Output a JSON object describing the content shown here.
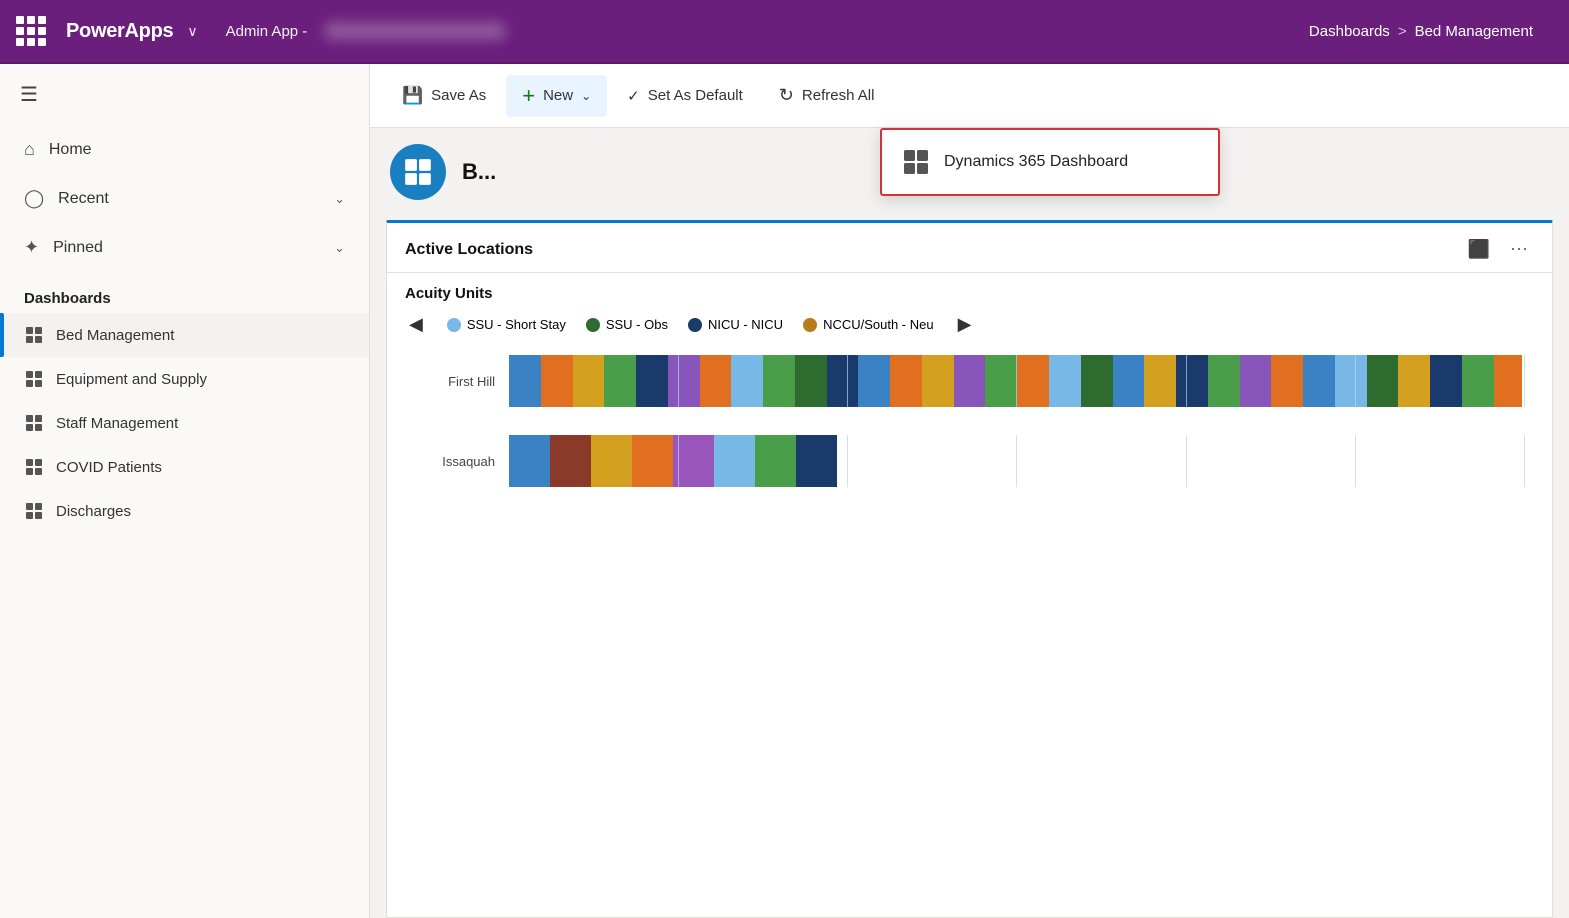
{
  "topbar": {
    "brand": "PowerApps",
    "chevron": "∨",
    "app_name": "Admin App -",
    "breadcrumb_section": "Dashboards",
    "breadcrumb_sep": ">",
    "breadcrumb_page": "Bed Management"
  },
  "toolbar": {
    "save_as_label": "Save As",
    "new_label": "New",
    "set_default_label": "Set As Default",
    "refresh_label": "Refresh All"
  },
  "dropdown": {
    "item_label": "Dynamics 365 Dashboard"
  },
  "sidebar": {
    "home_label": "Home",
    "recent_label": "Recent",
    "pinned_label": "Pinned",
    "dashboards_label": "Dashboards",
    "items": [
      {
        "label": "Bed Management",
        "active": true
      },
      {
        "label": "Equipment and Supply",
        "active": false
      },
      {
        "label": "Staff Management",
        "active": false
      },
      {
        "label": "COVID Patients",
        "active": false
      },
      {
        "label": "Discharges",
        "active": false
      }
    ]
  },
  "dashboard": {
    "title": "B...",
    "chart": {
      "title": "Active Locations",
      "subtitle": "Acuity Units",
      "legend": [
        {
          "label": "SSU - Short Stay",
          "color": "#78b8e6"
        },
        {
          "label": "SSU - Obs",
          "color": "#2e6b2e"
        },
        {
          "label": "NICU - NICU",
          "color": "#1a3a6b"
        },
        {
          "label": "NCCU/South - Neu",
          "color": "#b87c1a"
        }
      ],
      "rows": [
        {
          "label": "First Hill",
          "segments": [
            {
              "color": "#3b82c4",
              "width": 3
            },
            {
              "color": "#e07020",
              "width": 3
            },
            {
              "color": "#d4a020",
              "width": 3
            },
            {
              "color": "#4a9e4a",
              "width": 3
            },
            {
              "color": "#1a3a6b",
              "width": 3
            },
            {
              "color": "#8855bb",
              "width": 3
            },
            {
              "color": "#e07020",
              "width": 3
            },
            {
              "color": "#78b8e6",
              "width": 3
            },
            {
              "color": "#4a9e4a",
              "width": 3
            },
            {
              "color": "#2e6b2e",
              "width": 3
            },
            {
              "color": "#1a3a6b",
              "width": 3
            },
            {
              "color": "#3b82c4",
              "width": 3
            },
            {
              "color": "#e07020",
              "width": 3
            },
            {
              "color": "#d4a020",
              "width": 3
            },
            {
              "color": "#8855bb",
              "width": 3
            },
            {
              "color": "#4a9e4a",
              "width": 3
            },
            {
              "color": "#e07020",
              "width": 3
            },
            {
              "color": "#78b8e6",
              "width": 3
            },
            {
              "color": "#2e6b2e",
              "width": 3
            },
            {
              "color": "#3b82c4",
              "width": 3
            },
            {
              "color": "#d4a020",
              "width": 3
            },
            {
              "color": "#1a3a6b",
              "width": 3
            },
            {
              "color": "#4a9e4a",
              "width": 3
            },
            {
              "color": "#8855bb",
              "width": 3
            },
            {
              "color": "#e07020",
              "width": 3
            },
            {
              "color": "#3b82c4",
              "width": 3
            },
            {
              "color": "#78b8e6",
              "width": 3
            },
            {
              "color": "#2e6b2e",
              "width": 3
            },
            {
              "color": "#d4a020",
              "width": 3
            },
            {
              "color": "#1a3a6b",
              "width": 3
            },
            {
              "color": "#4a9e4a",
              "width": 3
            },
            {
              "color": "#e07020",
              "width": 3
            }
          ]
        },
        {
          "label": "Issaquah",
          "segments": [
            {
              "color": "#3b82c4",
              "width": 4
            },
            {
              "color": "#8b3a2a",
              "width": 4
            },
            {
              "color": "#d4a020",
              "width": 4
            },
            {
              "color": "#e07020",
              "width": 4
            },
            {
              "color": "#9955bb",
              "width": 4
            },
            {
              "color": "#78b8e6",
              "width": 4
            },
            {
              "color": "#4a9e4a",
              "width": 4
            },
            {
              "color": "#1a3a6b",
              "width": 4
            }
          ]
        }
      ]
    }
  },
  "colors": {
    "topbar_bg": "#6b1f7c",
    "active_indicator": "#0078d4",
    "new_icon_color": "#107c10"
  }
}
